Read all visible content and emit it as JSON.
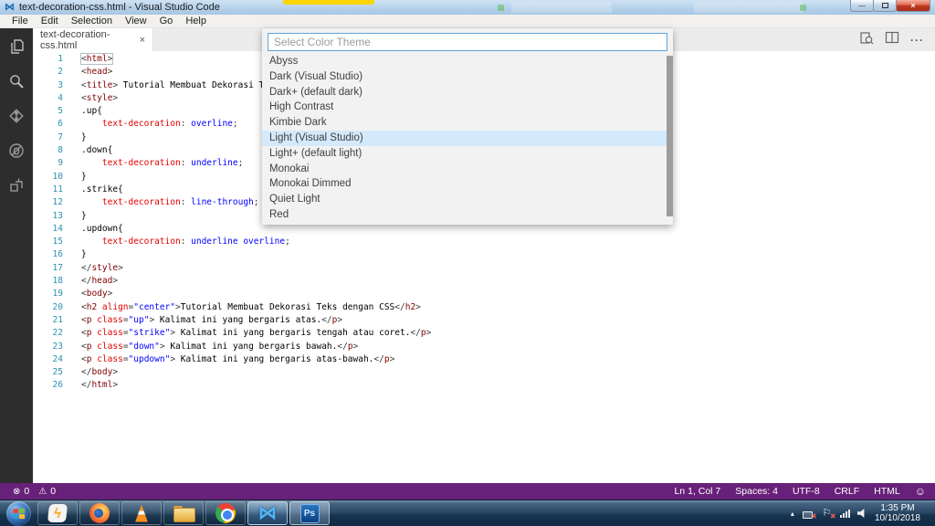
{
  "window": {
    "title": "text-decoration-css.html - Visual Studio Code",
    "controls": {
      "minimize": "—",
      "maximize": "",
      "close": "×"
    }
  },
  "icons": {
    "vscode_logo": "⋈",
    "winamp": "ϟ",
    "ps_label": "Ps",
    "tab_close": "×",
    "ellipsis": "···",
    "error": "⊗",
    "warning": "⚠",
    "smiley": "☺",
    "tray_arrow": "▴",
    "flag": "⚐",
    "badge_x": "×"
  },
  "menu_bar": {
    "items": [
      "File",
      "Edit",
      "Selection",
      "View",
      "Go",
      "Help"
    ]
  },
  "activity_bar": {
    "items": [
      "explorer",
      "search",
      "source-control",
      "debug",
      "extensions"
    ]
  },
  "tab_bar": {
    "tabs": [
      {
        "label": "text-decoration-css.html",
        "active": true
      }
    ]
  },
  "theme_picker": {
    "placeholder": "Select Color Theme",
    "selected": "Light (Visual Studio)",
    "items": [
      "Abyss",
      "Dark (Visual Studio)",
      "Dark+ (default dark)",
      "High Contrast",
      "Kimbie Dark",
      "Light (Visual Studio)",
      "Light+ (default light)",
      "Monokai",
      "Monokai Dimmed",
      "Quiet Light",
      "Red"
    ]
  },
  "editor": {
    "cursor": {
      "line": 1,
      "col": 7
    },
    "lines": [
      [
        [
          "p",
          "<"
        ],
        [
          "t",
          "html"
        ],
        [
          "p",
          ">"
        ]
      ],
      [
        [
          "p",
          "<"
        ],
        [
          "t",
          "head"
        ],
        [
          "p",
          ">"
        ]
      ],
      [
        [
          "p",
          "<"
        ],
        [
          "t",
          "title"
        ],
        [
          "p",
          ">"
        ],
        [
          "x",
          " Tutorial Membuat Dekorasi T"
        ]
      ],
      [
        [
          "p",
          "<"
        ],
        [
          "t",
          "style"
        ],
        [
          "p",
          ">"
        ]
      ],
      [
        [
          "x",
          ".up{"
        ]
      ],
      [
        [
          "x",
          "    "
        ],
        [
          "r",
          "text-decoration"
        ],
        [
          "p",
          ":"
        ],
        [
          "v",
          " overline"
        ],
        [
          "p",
          ";"
        ]
      ],
      [
        [
          "x",
          "}"
        ]
      ],
      [
        [
          "x",
          ".down{"
        ]
      ],
      [
        [
          "x",
          "    "
        ],
        [
          "r",
          "text-decoration"
        ],
        [
          "p",
          ":"
        ],
        [
          "v",
          " underline"
        ],
        [
          "p",
          ";"
        ]
      ],
      [
        [
          "x",
          "}"
        ]
      ],
      [
        [
          "x",
          ".strike{"
        ]
      ],
      [
        [
          "x",
          "    "
        ],
        [
          "r",
          "text-decoration"
        ],
        [
          "p",
          ":"
        ],
        [
          "v",
          " line-through"
        ],
        [
          "p",
          ";"
        ]
      ],
      [
        [
          "x",
          "}"
        ]
      ],
      [
        [
          "x",
          ".updown{"
        ]
      ],
      [
        [
          "x",
          "    "
        ],
        [
          "r",
          "text-decoration"
        ],
        [
          "p",
          ":"
        ],
        [
          "v",
          " underline overline"
        ],
        [
          "p",
          ";"
        ]
      ],
      [
        [
          "x",
          "}"
        ]
      ],
      [
        [
          "p",
          "</"
        ],
        [
          "t",
          "style"
        ],
        [
          "p",
          ">"
        ]
      ],
      [
        [
          "p",
          "</"
        ],
        [
          "t",
          "head"
        ],
        [
          "p",
          ">"
        ]
      ],
      [
        [
          "p",
          "<"
        ],
        [
          "t",
          "body"
        ],
        [
          "p",
          ">"
        ]
      ],
      [
        [
          "p",
          "<"
        ],
        [
          "t",
          "h2"
        ],
        [
          "x",
          " "
        ],
        [
          "a",
          "align"
        ],
        [
          "p",
          "="
        ],
        [
          "s",
          "\"center\""
        ],
        [
          "p",
          ">"
        ],
        [
          "x",
          "Tutorial Membuat Dekorasi Teks dengan CSS"
        ],
        [
          "p",
          "</"
        ],
        [
          "t",
          "h2"
        ],
        [
          "p",
          ">"
        ]
      ],
      [
        [
          "p",
          "<"
        ],
        [
          "t",
          "p"
        ],
        [
          "x",
          " "
        ],
        [
          "a",
          "class"
        ],
        [
          "p",
          "="
        ],
        [
          "s",
          "\"up\""
        ],
        [
          "p",
          ">"
        ],
        [
          "x",
          " Kalimat ini yang bergaris atas."
        ],
        [
          "p",
          "</"
        ],
        [
          "t",
          "p"
        ],
        [
          "p",
          ">"
        ]
      ],
      [
        [
          "p",
          "<"
        ],
        [
          "t",
          "p"
        ],
        [
          "x",
          " "
        ],
        [
          "a",
          "class"
        ],
        [
          "p",
          "="
        ],
        [
          "s",
          "\"strike\""
        ],
        [
          "p",
          ">"
        ],
        [
          "x",
          " Kalimat ini yang bergaris tengah atau coret."
        ],
        [
          "p",
          "</"
        ],
        [
          "t",
          "p"
        ],
        [
          "p",
          ">"
        ]
      ],
      [
        [
          "p",
          "<"
        ],
        [
          "t",
          "p"
        ],
        [
          "x",
          " "
        ],
        [
          "a",
          "class"
        ],
        [
          "p",
          "="
        ],
        [
          "s",
          "\"down\""
        ],
        [
          "p",
          ">"
        ],
        [
          "x",
          " Kalimat ini yang bergaris bawah."
        ],
        [
          "p",
          "</"
        ],
        [
          "t",
          "p"
        ],
        [
          "p",
          ">"
        ]
      ],
      [
        [
          "p",
          "<"
        ],
        [
          "t",
          "p"
        ],
        [
          "x",
          " "
        ],
        [
          "a",
          "class"
        ],
        [
          "p",
          "="
        ],
        [
          "s",
          "\"updown\""
        ],
        [
          "p",
          ">"
        ],
        [
          "x",
          " Kalimat ini yang bergaris atas-bawah."
        ],
        [
          "p",
          "</"
        ],
        [
          "t",
          "p"
        ],
        [
          "p",
          ">"
        ]
      ],
      [
        [
          "p",
          "</"
        ],
        [
          "t",
          "body"
        ],
        [
          "p",
          ">"
        ]
      ],
      [
        [
          "p",
          "</"
        ],
        [
          "t",
          "html"
        ],
        [
          "p",
          ">"
        ]
      ]
    ]
  },
  "status_bar": {
    "errors": "0",
    "warnings": "0",
    "right_items": [
      "Ln 1, Col 7",
      "Spaces: 4",
      "UTF-8",
      "CRLF",
      "HTML"
    ],
    "background": "#68217a"
  },
  "taskbar": {
    "apps": [
      "start",
      "winamp",
      "firefox",
      "vlc",
      "explorer",
      "chrome",
      "vscode",
      "photoshop"
    ],
    "active_app": "vscode",
    "tray_icons": [
      "show-hidden",
      "network-error",
      "action-center-error",
      "signal",
      "volume"
    ],
    "clock": {
      "time": "1:35 PM",
      "date": "10/10/2018"
    }
  },
  "colors": {
    "status_bar": "#68217a",
    "selection_highlight": "#d4e9fb",
    "activity_bar": "#2d2d2d",
    "line_number": "#2b91af",
    "tag": "#800000",
    "attribute": "#e50000",
    "string_value": "#0000ff"
  }
}
